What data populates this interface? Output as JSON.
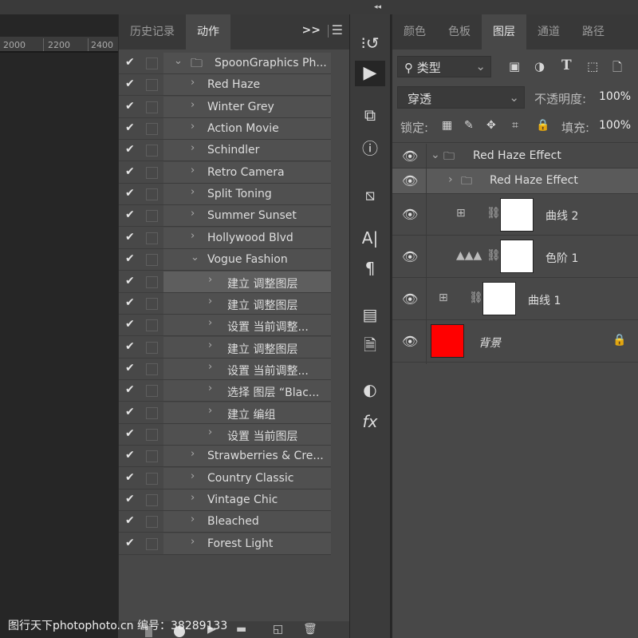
{
  "ruler": {
    "ticks": [
      "2000",
      "2200",
      "2400"
    ]
  },
  "actions_panel": {
    "tabs": [
      {
        "label": "历史记录"
      },
      {
        "label": "动作"
      }
    ],
    "expand_label": ">>",
    "rows": [
      {
        "label": "SpoonGraphics Ph...",
        "level": 0,
        "expanded": true,
        "folder": true
      },
      {
        "label": "Red Haze",
        "level": 1
      },
      {
        "label": "Winter Grey",
        "level": 1
      },
      {
        "label": "Action Movie",
        "level": 1
      },
      {
        "label": "Schindler",
        "level": 1
      },
      {
        "label": "Retro Camera",
        "level": 1
      },
      {
        "label": "Split Toning",
        "level": 1
      },
      {
        "label": "Summer Sunset",
        "level": 1
      },
      {
        "label": "Hollywood Blvd",
        "level": 1
      },
      {
        "label": "Vogue Fashion",
        "level": 1,
        "expanded": true
      },
      {
        "label": "建立 调整图层",
        "level": 2,
        "selected": true
      },
      {
        "label": "建立 调整图层",
        "level": 2
      },
      {
        "label": "设置 当前调整...",
        "level": 2
      },
      {
        "label": "建立 调整图层",
        "level": 2
      },
      {
        "label": "设置 当前调整...",
        "level": 2
      },
      {
        "label": "选择 图层 “Blac...",
        "level": 2
      },
      {
        "label": "建立 编组",
        "level": 2
      },
      {
        "label": "设置 当前图层",
        "level": 2
      },
      {
        "label": "Strawberries & Cre...",
        "level": 1
      },
      {
        "label": "Country Classic",
        "level": 1
      },
      {
        "label": "Vintage Chic",
        "level": 1
      },
      {
        "label": "Bleached",
        "level": 1
      },
      {
        "label": "Forest Light",
        "level": 1
      }
    ]
  },
  "layers_panel": {
    "tabs": [
      {
        "label": "颜色"
      },
      {
        "label": "色板"
      },
      {
        "label": "图层"
      },
      {
        "label": "通道"
      },
      {
        "label": "路径"
      }
    ],
    "filter": {
      "value": "类型"
    },
    "blend_mode": {
      "value": "穿透"
    },
    "opacity": {
      "label": "不透明度:",
      "value": "100%"
    },
    "lock": {
      "label": "锁定:"
    },
    "fill": {
      "label": "填充:",
      "value": "100%"
    },
    "layers": [
      {
        "name": "Red Haze Effect",
        "type": "group"
      },
      {
        "name": "Red Haze Effect",
        "type": "group"
      },
      {
        "name": "曲线 2",
        "type": "curves"
      },
      {
        "name": "色阶 1",
        "type": "levels"
      },
      {
        "name": "曲线 1",
        "type": "curves"
      },
      {
        "name": "背景",
        "type": "background",
        "color": "#ff0000",
        "locked": true
      }
    ]
  },
  "watermark": "图行天下photophoto.cn  编号：38289133"
}
